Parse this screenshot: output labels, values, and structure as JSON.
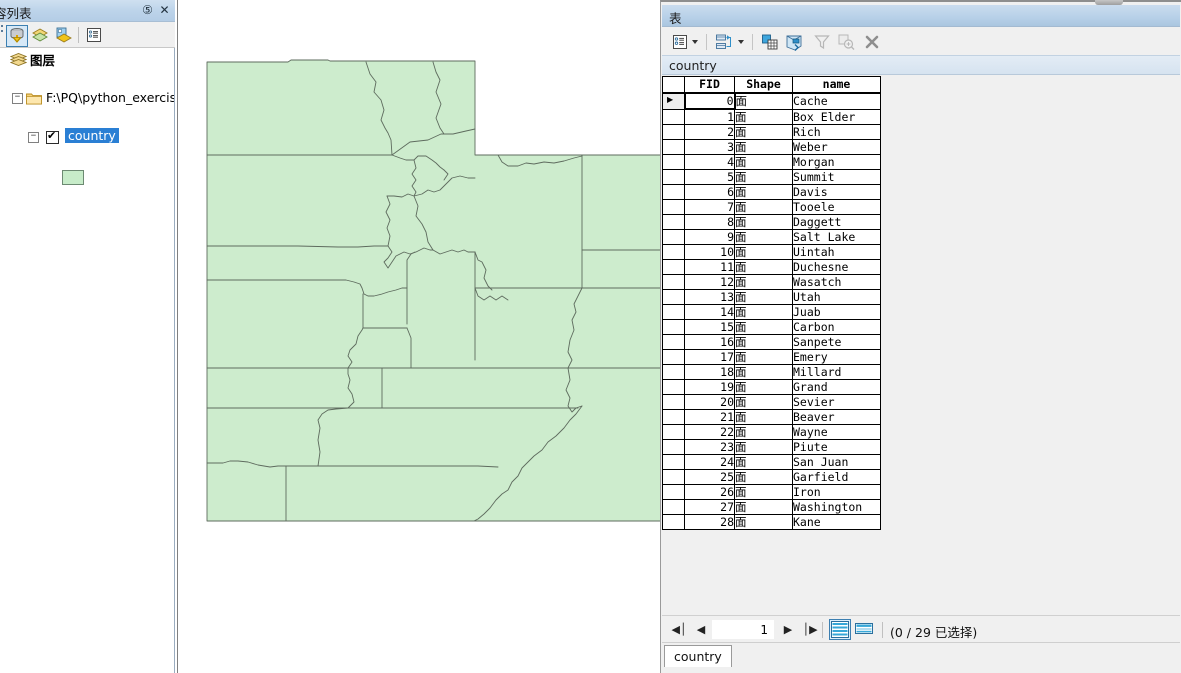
{
  "toc": {
    "title": "容列表",
    "pin_icon": "pin-icon",
    "close_icon": "close-icon",
    "toolbar": {
      "list_by_drawing_order": "list-by-drawing-order-icon",
      "list_by_source": "list-by-source-icon",
      "list_by_visibility": "list-by-visibility-icon",
      "options": "toc-options-icon"
    },
    "tree": {
      "layers_label": "图层",
      "folder_label": "F:\\PQ\\python_exercise",
      "layer_label": "country",
      "layer_checked": true,
      "symbol_color": "#c7ecc9",
      "symbol_outline": "#6c8a72",
      "expander_collapse": "−"
    }
  },
  "map": {
    "fill_color": "#cdeccd",
    "outline_color": "#5e6b5e",
    "background": "#ffffff"
  },
  "table_window": {
    "title": "表",
    "toolbar": {
      "table_options": "table-options-icon",
      "table_options_arrow": "chevron-down-icon",
      "related_tables": "related-tables-icon",
      "related_tables_arrow": "chevron-down-icon",
      "select_by_attributes": "select-by-attributes-icon",
      "switch_selection": "switch-selection-icon",
      "clear_selection": "clear-selection-icon",
      "zoom_to_selected": "zoom-to-selected-icon",
      "delete_selected": "delete-selected-icon"
    },
    "tab_header": "country",
    "columns": [
      "",
      "FID",
      "Shape",
      "name"
    ],
    "rows": [
      {
        "fid": "0",
        "shape": "面",
        "name": "Cache"
      },
      {
        "fid": "1",
        "shape": "面",
        "name": "Box Elder"
      },
      {
        "fid": "2",
        "shape": "面",
        "name": "Rich"
      },
      {
        "fid": "3",
        "shape": "面",
        "name": "Weber"
      },
      {
        "fid": "4",
        "shape": "面",
        "name": "Morgan"
      },
      {
        "fid": "5",
        "shape": "面",
        "name": "Summit"
      },
      {
        "fid": "6",
        "shape": "面",
        "name": "Davis"
      },
      {
        "fid": "7",
        "shape": "面",
        "name": "Tooele"
      },
      {
        "fid": "8",
        "shape": "面",
        "name": "Daggett"
      },
      {
        "fid": "9",
        "shape": "面",
        "name": "Salt Lake"
      },
      {
        "fid": "10",
        "shape": "面",
        "name": "Uintah"
      },
      {
        "fid": "11",
        "shape": "面",
        "name": "Duchesne"
      },
      {
        "fid": "12",
        "shape": "面",
        "name": "Wasatch"
      },
      {
        "fid": "13",
        "shape": "面",
        "name": "Utah"
      },
      {
        "fid": "14",
        "shape": "面",
        "name": "Juab"
      },
      {
        "fid": "15",
        "shape": "面",
        "name": "Carbon"
      },
      {
        "fid": "16",
        "shape": "面",
        "name": "Sanpete"
      },
      {
        "fid": "17",
        "shape": "面",
        "name": "Emery"
      },
      {
        "fid": "18",
        "shape": "面",
        "name": "Millard"
      },
      {
        "fid": "19",
        "shape": "面",
        "name": "Grand"
      },
      {
        "fid": "20",
        "shape": "面",
        "name": "Sevier"
      },
      {
        "fid": "21",
        "shape": "面",
        "name": "Beaver"
      },
      {
        "fid": "22",
        "shape": "面",
        "name": "Wayne"
      },
      {
        "fid": "23",
        "shape": "面",
        "name": "Piute"
      },
      {
        "fid": "24",
        "shape": "面",
        "name": "San Juan"
      },
      {
        "fid": "25",
        "shape": "面",
        "name": "Garfield"
      },
      {
        "fid": "26",
        "shape": "面",
        "name": "Iron"
      },
      {
        "fid": "27",
        "shape": "面",
        "name": "Washington"
      },
      {
        "fid": "28",
        "shape": "面",
        "name": "Kane"
      }
    ],
    "current_row_index": 0,
    "status": {
      "first_icon": "◀│",
      "prev_icon": "◀",
      "next_icon": "▶",
      "last_icon": "│▶",
      "record_number": "1",
      "view_table_icon": "table-view-icon",
      "view_form_icon": "form-view-icon",
      "selection_text": "(0 / 29 已选择)"
    },
    "bottom_tab": "country"
  }
}
